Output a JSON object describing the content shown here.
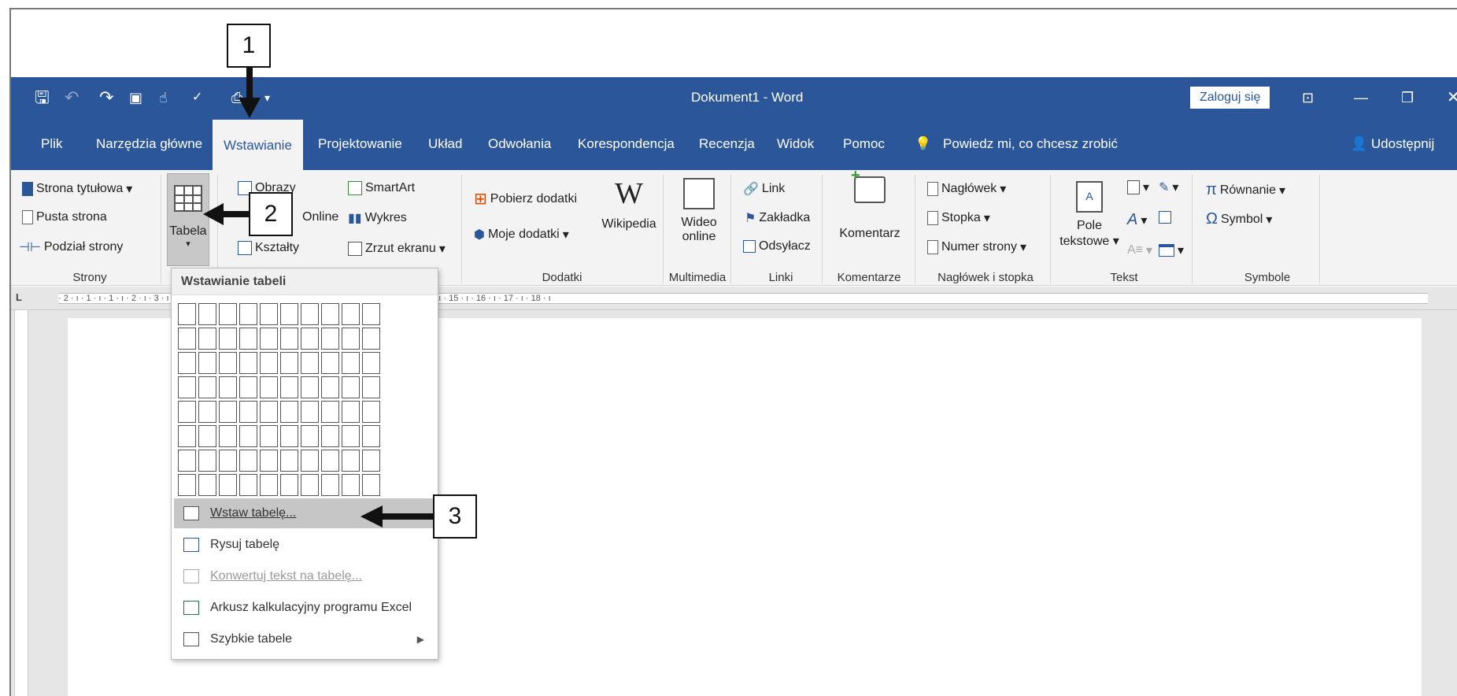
{
  "title_bar": {
    "document_title": "Dokument1 - Word",
    "signin": "Zaloguj się"
  },
  "qat_icons": [
    "save-icon",
    "undo-icon",
    "redo-icon",
    "format-icon",
    "touch-icon",
    "spelling-icon",
    "print-icon",
    "customize-icon"
  ],
  "tabs": [
    "Plik",
    "Narzędzia główne",
    "Wstawianie",
    "Projektowanie",
    "Układ",
    "Odwołania",
    "Korespondencja",
    "Recenzja",
    "Widok",
    "Pomoc"
  ],
  "active_tab": "Wstawianie",
  "tell_me": "Powiedz mi, co chcesz zrobić",
  "share": "Udostępnij",
  "ribbon": {
    "strony": {
      "items": [
        "Strona tytułowa",
        "Pusta strona",
        "Podział strony"
      ],
      "label": "Strony"
    },
    "tabela": {
      "label": "Tabela"
    },
    "ilustracje": {
      "obrazy": "Obrazy",
      "online": "Online",
      "ksztalty": "Kształty",
      "smartart": "SmartArt",
      "wykres": "Wykres",
      "zrzut": "Zrzut ekranu"
    },
    "dodatki": {
      "pobierz": "Pobierz dodatki",
      "moje": "Moje dodatki",
      "wikipedia": "Wikipedia",
      "label": "Dodatki"
    },
    "multimedia": {
      "wideo1": "Wideo",
      "wideo2": "online",
      "label": "Multimedia"
    },
    "linki": {
      "items": [
        "Link",
        "Zakładka",
        "Odsyłacz"
      ],
      "label": "Linki"
    },
    "komentarze": {
      "item": "Komentarz",
      "label": "Komentarze"
    },
    "naglowek": {
      "items": [
        "Nagłówek",
        "Stopka",
        "Numer strony"
      ],
      "label": "Nagłówek i stopka"
    },
    "tekst": {
      "pole1": "Pole",
      "pole2": "tekstowe",
      "label": "Tekst"
    },
    "symbole": {
      "rownanie": "Równanie",
      "symbol": "Symbol",
      "label": "Symbole"
    }
  },
  "ruler_text": "· 2 · ı · 1 · ı · 1 · ı · 2 · ı · 3 · ı · 4 · ı · 5 · ı · 6 · ı · 7 · ı · 8 · ı · 9 · ı · 10 · ı · 11 · ı · 12 · ı · 13 · ı · 14 · ı · 15 · ı · 16 · ı · 17 · ı · 18 · ı",
  "dropdown": {
    "header": "Wstawianie tabeli",
    "menu": [
      {
        "label": "Wstaw tabelę..."
      },
      {
        "label": "Rysuj tabelę"
      },
      {
        "label": "Konwertuj tekst na tabelę..."
      },
      {
        "label": "Arkusz kalkulacyjny programu Excel"
      },
      {
        "label": "Szybkie tabele"
      }
    ]
  },
  "callouts": [
    "1",
    "2",
    "3"
  ]
}
